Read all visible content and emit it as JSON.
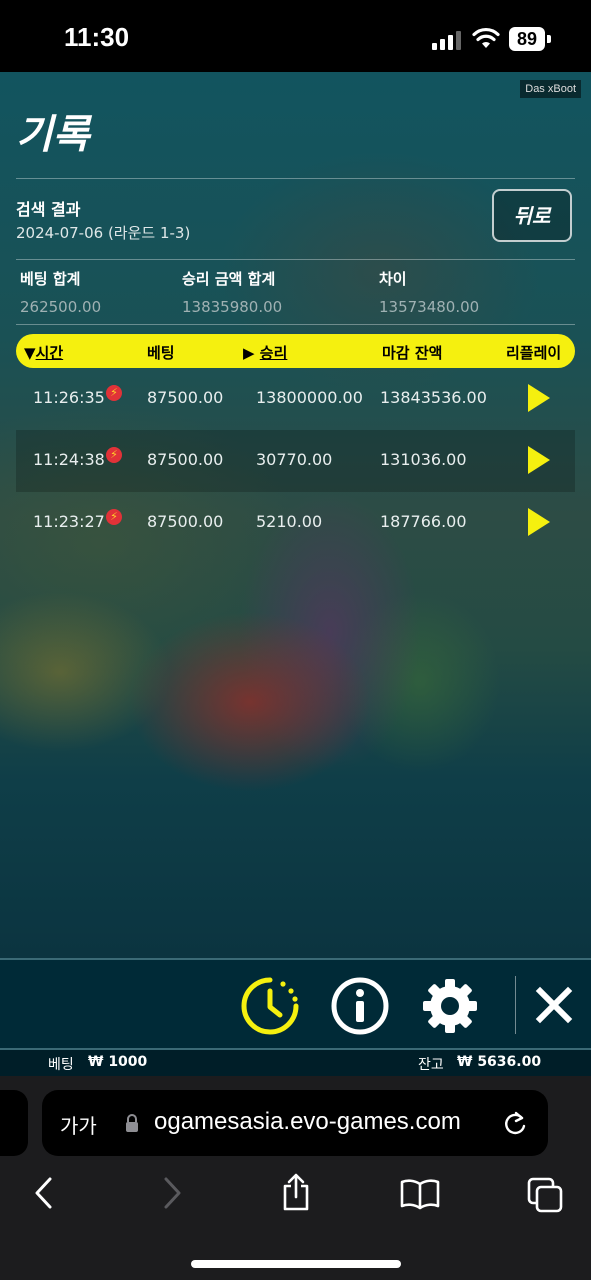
{
  "status_bar": {
    "time": "11:30",
    "battery": "89"
  },
  "game": {
    "brand": "Das xBoot",
    "title": "기록",
    "search": {
      "label": "검색 결과",
      "value": "2024-07-06 (라운드 1-3)"
    },
    "back_label": "뒤로",
    "summary": {
      "bet_total_label": "베팅 합계",
      "bet_total": "262500.00",
      "win_total_label": "승리 금액 합계",
      "win_total": "13835980.00",
      "diff_label": "차이",
      "diff": "13573480.00"
    },
    "table": {
      "headers": {
        "time": "시간",
        "bet": "베팅",
        "win": "승리",
        "balance": "마감 잔액",
        "replay": "리플레이"
      },
      "rows": [
        {
          "time": "11:26:35",
          "bet": "87500.00",
          "win": "13800000.00",
          "balance": "13843536.00"
        },
        {
          "time": "11:24:38",
          "bet": "87500.00",
          "win": "30770.00",
          "balance": "131036.00"
        },
        {
          "time": "11:23:27",
          "bet": "87500.00",
          "win": "5210.00",
          "balance": "187766.00"
        }
      ]
    },
    "footer": {
      "bet_label": "베팅",
      "bet_value": "₩ 1000",
      "balance_label": "잔고",
      "balance_value": "₩ 5636.00"
    }
  },
  "browser": {
    "text_size_label": "가가",
    "url": "ogamesasia.evo-games.com"
  },
  "colors": {
    "accent": "#f5f00f",
    "toolbar_bg": "#002a37"
  }
}
